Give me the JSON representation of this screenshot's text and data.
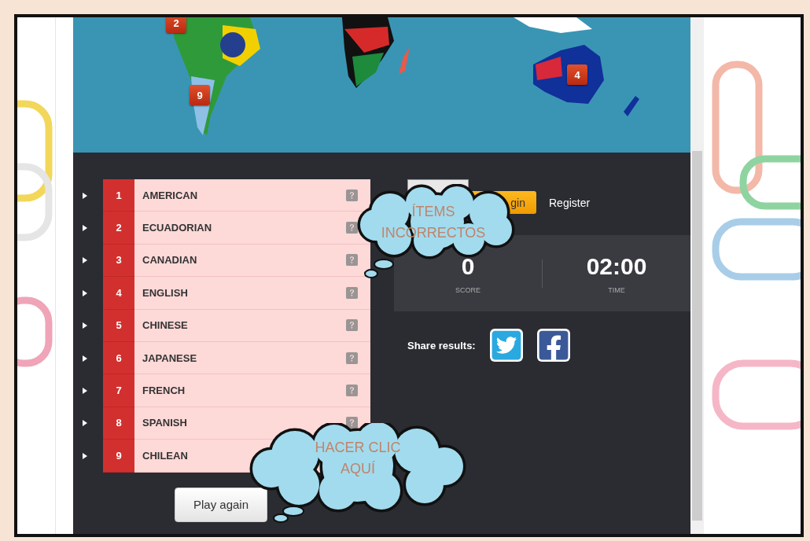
{
  "map": {
    "markers": [
      {
        "label": "2"
      },
      {
        "label": "9"
      },
      {
        "label": "4"
      }
    ]
  },
  "answers": [
    {
      "number": "1",
      "name": "AMERICAN"
    },
    {
      "number": "2",
      "name": "ECUADORIAN"
    },
    {
      "number": "3",
      "name": "CANADIAN"
    },
    {
      "number": "4",
      "name": "ENGLISH"
    },
    {
      "number": "5",
      "name": "CHINESE"
    },
    {
      "number": "6",
      "name": "JAPANESE"
    },
    {
      "number": "7",
      "name": "FRENCH"
    },
    {
      "number": "8",
      "name": "SPANISH"
    },
    {
      "number": "9",
      "name": "CHILEAN"
    }
  ],
  "auth": {
    "login": "gin",
    "register": "Register"
  },
  "stats": [
    {
      "value": "0",
      "label": "SCORE"
    },
    {
      "value": "02:00",
      "label": "TIME"
    }
  ],
  "share": {
    "label": "Share results:"
  },
  "play_button": "Play again",
  "annotations": [
    {
      "text": "ÍTEMS INCORRECTOS"
    },
    {
      "text": "HACER CLIC AQUÍ"
    }
  ]
}
